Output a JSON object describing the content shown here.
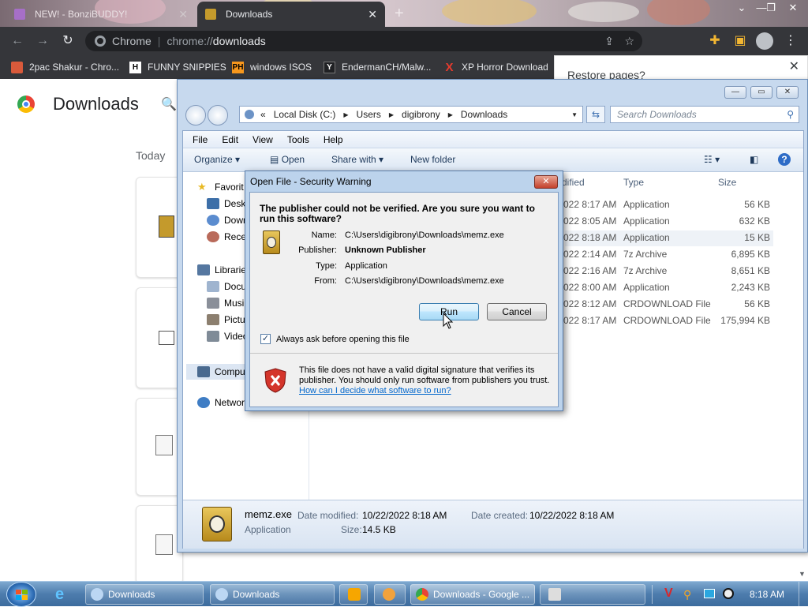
{
  "browser": {
    "tabs": [
      {
        "label": "NEW! - BonziBUDDY!"
      },
      {
        "label": "Downloads"
      }
    ],
    "omnibox": {
      "site_label": "Chrome",
      "url_prefix": "chrome://",
      "url_path": "downloads"
    },
    "bookmarks": [
      {
        "label": "2pac Shakur - Chro..."
      },
      {
        "label": "FUNNY SNIPPIES",
        "badge": "H"
      },
      {
        "label": "windows ISOS",
        "badge": "PH"
      },
      {
        "label": "EndermanCH/Malw...",
        "badge": "Y"
      },
      {
        "label": "XP Horror Download",
        "badge": "X"
      }
    ]
  },
  "downloads_page": {
    "title": "Downloads",
    "section_today": "Today",
    "restore_banner": "Restore pages?"
  },
  "explorer": {
    "breadcrumb": [
      "«",
      "Local Disk (C:)",
      "Users",
      "digibrony",
      "Downloads"
    ],
    "search_placeholder": "Search Downloads",
    "menu": [
      "File",
      "Edit",
      "View",
      "Tools",
      "Help"
    ],
    "commands": {
      "organize": "Organize",
      "open": "Open",
      "share_with": "Share with",
      "new_folder": "New folder"
    },
    "nav": {
      "favorites": "Favorit",
      "desktop": "Deskt",
      "downloads": "Down",
      "recent": "Recen",
      "libraries": "Librarie",
      "documents": "Docu",
      "music": "Musi",
      "pictures": "Pictu",
      "videos": "Video",
      "computer": "Compu",
      "network": "Networ"
    },
    "columns": {
      "date": "dified",
      "type": "Type",
      "size": "Size"
    },
    "rows": [
      {
        "date": "022 8:17 AM",
        "type": "Application",
        "size": "56 KB"
      },
      {
        "date": "022 8:05 AM",
        "type": "Application",
        "size": "632 KB"
      },
      {
        "date": "022 8:18 AM",
        "type": "Application",
        "size": "15 KB"
      },
      {
        "date": "022 2:14 AM",
        "type": "7z Archive",
        "size": "6,895 KB"
      },
      {
        "date": "022 2:16 AM",
        "type": "7z Archive",
        "size": "8,651 KB"
      },
      {
        "date": "022 8:00 AM",
        "type": "Application",
        "size": "2,243 KB"
      },
      {
        "date": "022 8:12 AM",
        "type": "CRDOWNLOAD File",
        "size": "56 KB"
      },
      {
        "date": "022 8:17 AM",
        "type": "CRDOWNLOAD File",
        "size": "175,994 KB"
      }
    ],
    "details": {
      "name": "memz.exe",
      "date_modified_label": "Date modified:",
      "date_modified": "10/22/2022 8:18 AM",
      "date_created_label": "Date created:",
      "date_created": "10/22/2022 8:18 AM",
      "type": "Application",
      "size_label": "Size:",
      "size": "14.5 KB"
    }
  },
  "dialog": {
    "title": "Open File - Security Warning",
    "question": "The publisher could not be verified.  Are you sure you want to run this software?",
    "fields": {
      "name_label": "Name:",
      "name": "C:\\Users\\digibrony\\Downloads\\memz.exe",
      "publisher_label": "Publisher:",
      "publisher": "Unknown Publisher",
      "type_label": "Type:",
      "type": "Application",
      "from_label": "From:",
      "from": "C:\\Users\\digibrony\\Downloads\\memz.exe"
    },
    "run_button": "Run",
    "cancel_button": "Cancel",
    "always_ask": "Always ask before opening this file",
    "always_ask_checked": true,
    "warning_text": "This file does not have a valid digital signature that verifies its publisher.  You should only run software from publishers you trust.",
    "help_link": "How can I decide what software to run?"
  },
  "taskbar": {
    "items": [
      {
        "label": "Downloads"
      },
      {
        "label": "Downloads"
      },
      {
        "label": "Downloads - Google ..."
      }
    ],
    "clock": "8:18 AM"
  },
  "colors": {
    "chrome_dark": "#35363a",
    "dialog_frame": "#bcd3ec",
    "link": "#0066cc",
    "taskbar": "#4d7cad"
  }
}
